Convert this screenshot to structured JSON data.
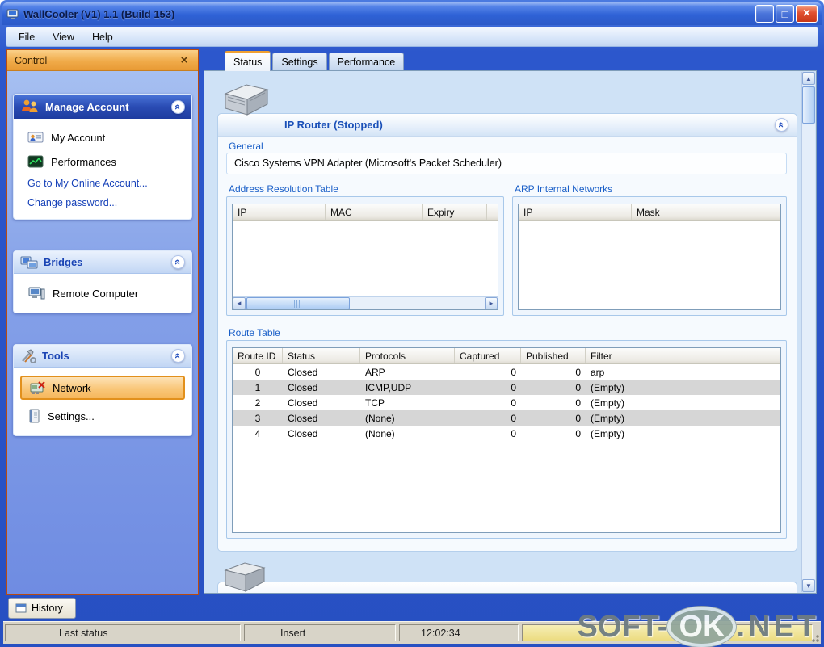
{
  "window": {
    "title": "WallCooler (V1) 1.1 (Build 153)"
  },
  "menu": {
    "items": [
      {
        "label": "File"
      },
      {
        "label": "View"
      },
      {
        "label": "Help"
      }
    ]
  },
  "control": {
    "title": "Control",
    "manage_account": {
      "title": "Manage Account",
      "items": [
        {
          "label": "My Account"
        },
        {
          "label": "Performances"
        }
      ],
      "links": [
        {
          "label": "Go to My Online Account..."
        },
        {
          "label": "Change password..."
        }
      ]
    },
    "bridges": {
      "title": "Bridges",
      "items": [
        {
          "label": "Remote Computer"
        }
      ]
    },
    "tools": {
      "title": "Tools",
      "items": [
        {
          "label": "Network"
        },
        {
          "label": "Settings..."
        }
      ]
    }
  },
  "tabs": {
    "items": [
      {
        "label": "Status"
      },
      {
        "label": "Settings"
      },
      {
        "label": "Performance"
      }
    ]
  },
  "router": {
    "title": "IP Router (Stopped)",
    "general_label": "General",
    "general_value": "Cisco Systems VPN Adapter (Microsoft's Packet Scheduler)"
  },
  "arp_table": {
    "title": "Address Resolution Table",
    "columns": [
      "IP",
      "MAC",
      "Expiry"
    ],
    "rows": []
  },
  "arp_internal": {
    "title": "ARP Internal Networks",
    "columns": [
      "IP",
      "Mask"
    ],
    "rows": []
  },
  "route_table": {
    "title": "Route Table",
    "columns": [
      "Route ID",
      "Status",
      "Protocols",
      "Captured",
      "Published",
      "Filter"
    ],
    "rows": [
      [
        "0",
        "Closed",
        "ARP",
        "0",
        "0",
        "arp"
      ],
      [
        "1",
        "Closed",
        "ICMP,UDP",
        "0",
        "0",
        "(Empty)"
      ],
      [
        "2",
        "Closed",
        "TCP",
        "0",
        "0",
        "(Empty)"
      ],
      [
        "3",
        "Closed",
        "(None)",
        "0",
        "0",
        "(Empty)"
      ],
      [
        "4",
        "Closed",
        "(None)",
        "0",
        "0",
        "(Empty)"
      ]
    ]
  },
  "history": {
    "label": "History"
  },
  "status_bar": {
    "last_status": "Last status",
    "mode": "Insert",
    "time": "12:02:34"
  },
  "watermark": {
    "prefix": "SOFT-",
    "middle": "OK",
    "suffix": ".NET"
  },
  "colors": {
    "titlebar_blue": "#2d62cf",
    "selection_orange": "#e2901c",
    "link_blue": "#1540b8",
    "status_yellow": "#ecdc80"
  }
}
